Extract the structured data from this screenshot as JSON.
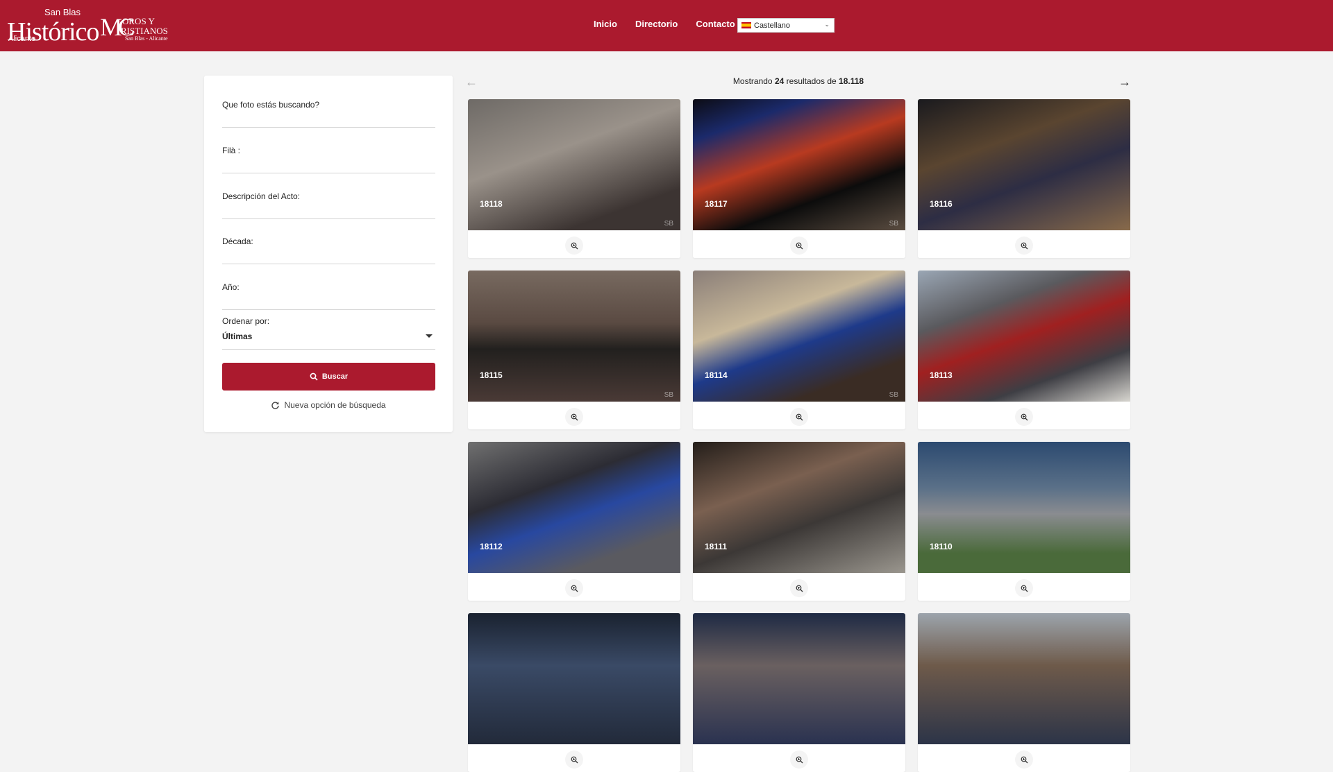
{
  "header": {
    "logo_primary": {
      "top": "San Blas",
      "main": "Histórico",
      "bottom": "Alicante"
    },
    "logo_secondary": {
      "main": "MC",
      "line1": "OROS Y",
      "line2": "RISTIANOS",
      "line3": "San Blas - Alicante"
    },
    "nav": [
      "Inicio",
      "Directorio",
      "Contacto"
    ],
    "language": "Castellano",
    "accent": "#ab1a2e"
  },
  "search": {
    "fields": [
      "Que foto estás buscando?",
      "Filà :",
      "Descripción del Acto:",
      "Década:",
      "Año:"
    ],
    "order_label": "Ordenar por:",
    "order_value": "Últimas",
    "button_label": "Buscar",
    "reset_label": "Nueva opción de búsqueda"
  },
  "results": {
    "shown": "24",
    "total": "18.118",
    "prefix": "Mostrando",
    "middle": "resultados de",
    "photos": [
      {
        "id": "18118",
        "watermark": "SB",
        "gradient": "linear-gradient(160deg,#6e6a66,#9a928a 40%,#3c3432 80%)"
      },
      {
        "id": "18117",
        "watermark": "SB",
        "gradient": "linear-gradient(160deg,#0c0c14 0%,#1b2a6b 20%,#b83a20 45%,#0c0c0c 70%,#5a4c40)"
      },
      {
        "id": "18116",
        "watermark": "",
        "gradient": "linear-gradient(160deg,#1a1a1e,#5a4530 35%,#2d2d44 60%,#886a4a)"
      },
      {
        "id": "18115",
        "watermark": "SB",
        "gradient": "linear-gradient(180deg,#786a60,#5a4a42 40%,#22201e 60%,#4a3a36)"
      },
      {
        "id": "18114",
        "watermark": "SB",
        "gradient": "linear-gradient(160deg,#8a7e78,#c8b89a 35%,#1e3a8a 55%,#3a2c24 80%)"
      },
      {
        "id": "18113",
        "watermark": "",
        "gradient": "linear-gradient(160deg,#9aa6b4,#5a5a5e 30%,#a02020 50%,#3e3e44 75%,#d8d6d0)"
      },
      {
        "id": "18112",
        "watermark": "",
        "gradient": "linear-gradient(160deg,#707070,#2c2c34 35%,#2848a0 55%,#5a5a60 80%)"
      },
      {
        "id": "18111",
        "watermark": "",
        "gradient": "linear-gradient(160deg,#241e1a,#7a6050 35%,#3c3836 60%,#9a968e)"
      },
      {
        "id": "18110",
        "watermark": "",
        "gradient": "linear-gradient(180deg,#2c4a70,#5a7088 35%,#8a8c90 55%,#4a6a3a 85%)"
      },
      {
        "id": "",
        "watermark": "",
        "gradient": "linear-gradient(180deg,#1a2230,#3a4a66 40%,#222a3a)"
      },
      {
        "id": "",
        "watermark": "",
        "gradient": "linear-gradient(180deg,#1e2a44,#6a6060 40%,#2a3250)"
      },
      {
        "id": "",
        "watermark": "",
        "gradient": "linear-gradient(180deg,#9ca4ac,#6e5a4a 40%,#2c3448)"
      }
    ]
  }
}
